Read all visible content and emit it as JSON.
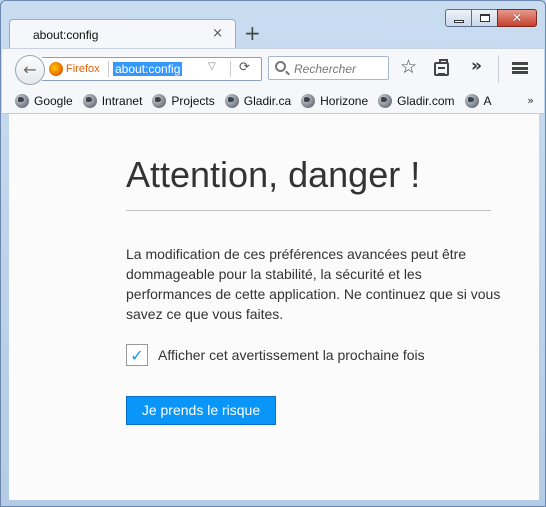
{
  "tab": {
    "title": "about:config",
    "close_glyph": "×"
  },
  "new_tab_glyph": "+",
  "window_controls": {
    "close_glyph": "✕"
  },
  "navbar": {
    "identity_label": "Firefox",
    "url": "about:config",
    "url_dropdown_glyph": "▽",
    "reload_glyph": "⟳",
    "search_placeholder": "Rechercher",
    "back_glyph": "←",
    "star_glyph": "☆",
    "overflow_glyph": "»"
  },
  "bookmarks": {
    "items": [
      {
        "label": "Google"
      },
      {
        "label": "Intranet"
      },
      {
        "label": "Projects"
      },
      {
        "label": "Gladir.ca"
      },
      {
        "label": "Horizone"
      },
      {
        "label": "Gladir.com"
      },
      {
        "label": "A"
      }
    ],
    "chevron_glyph": "»"
  },
  "page": {
    "title": "Attention, danger !",
    "description": "La modification de ces préférences avancées peut être dommageable pour la stabilité, la sécurité et les performances de cette application. Ne continuez que si vous savez ce que vous faites.",
    "checkbox_label": "Afficher cet avertissement la prochaine fois",
    "checkbox_checked": true,
    "checkbox_glyph": "✓",
    "button_label": "Je prends le risque"
  },
  "colors": {
    "accent": "#0996f8",
    "firefox_orange": "#e66000",
    "url_selection": "#3399ff"
  }
}
